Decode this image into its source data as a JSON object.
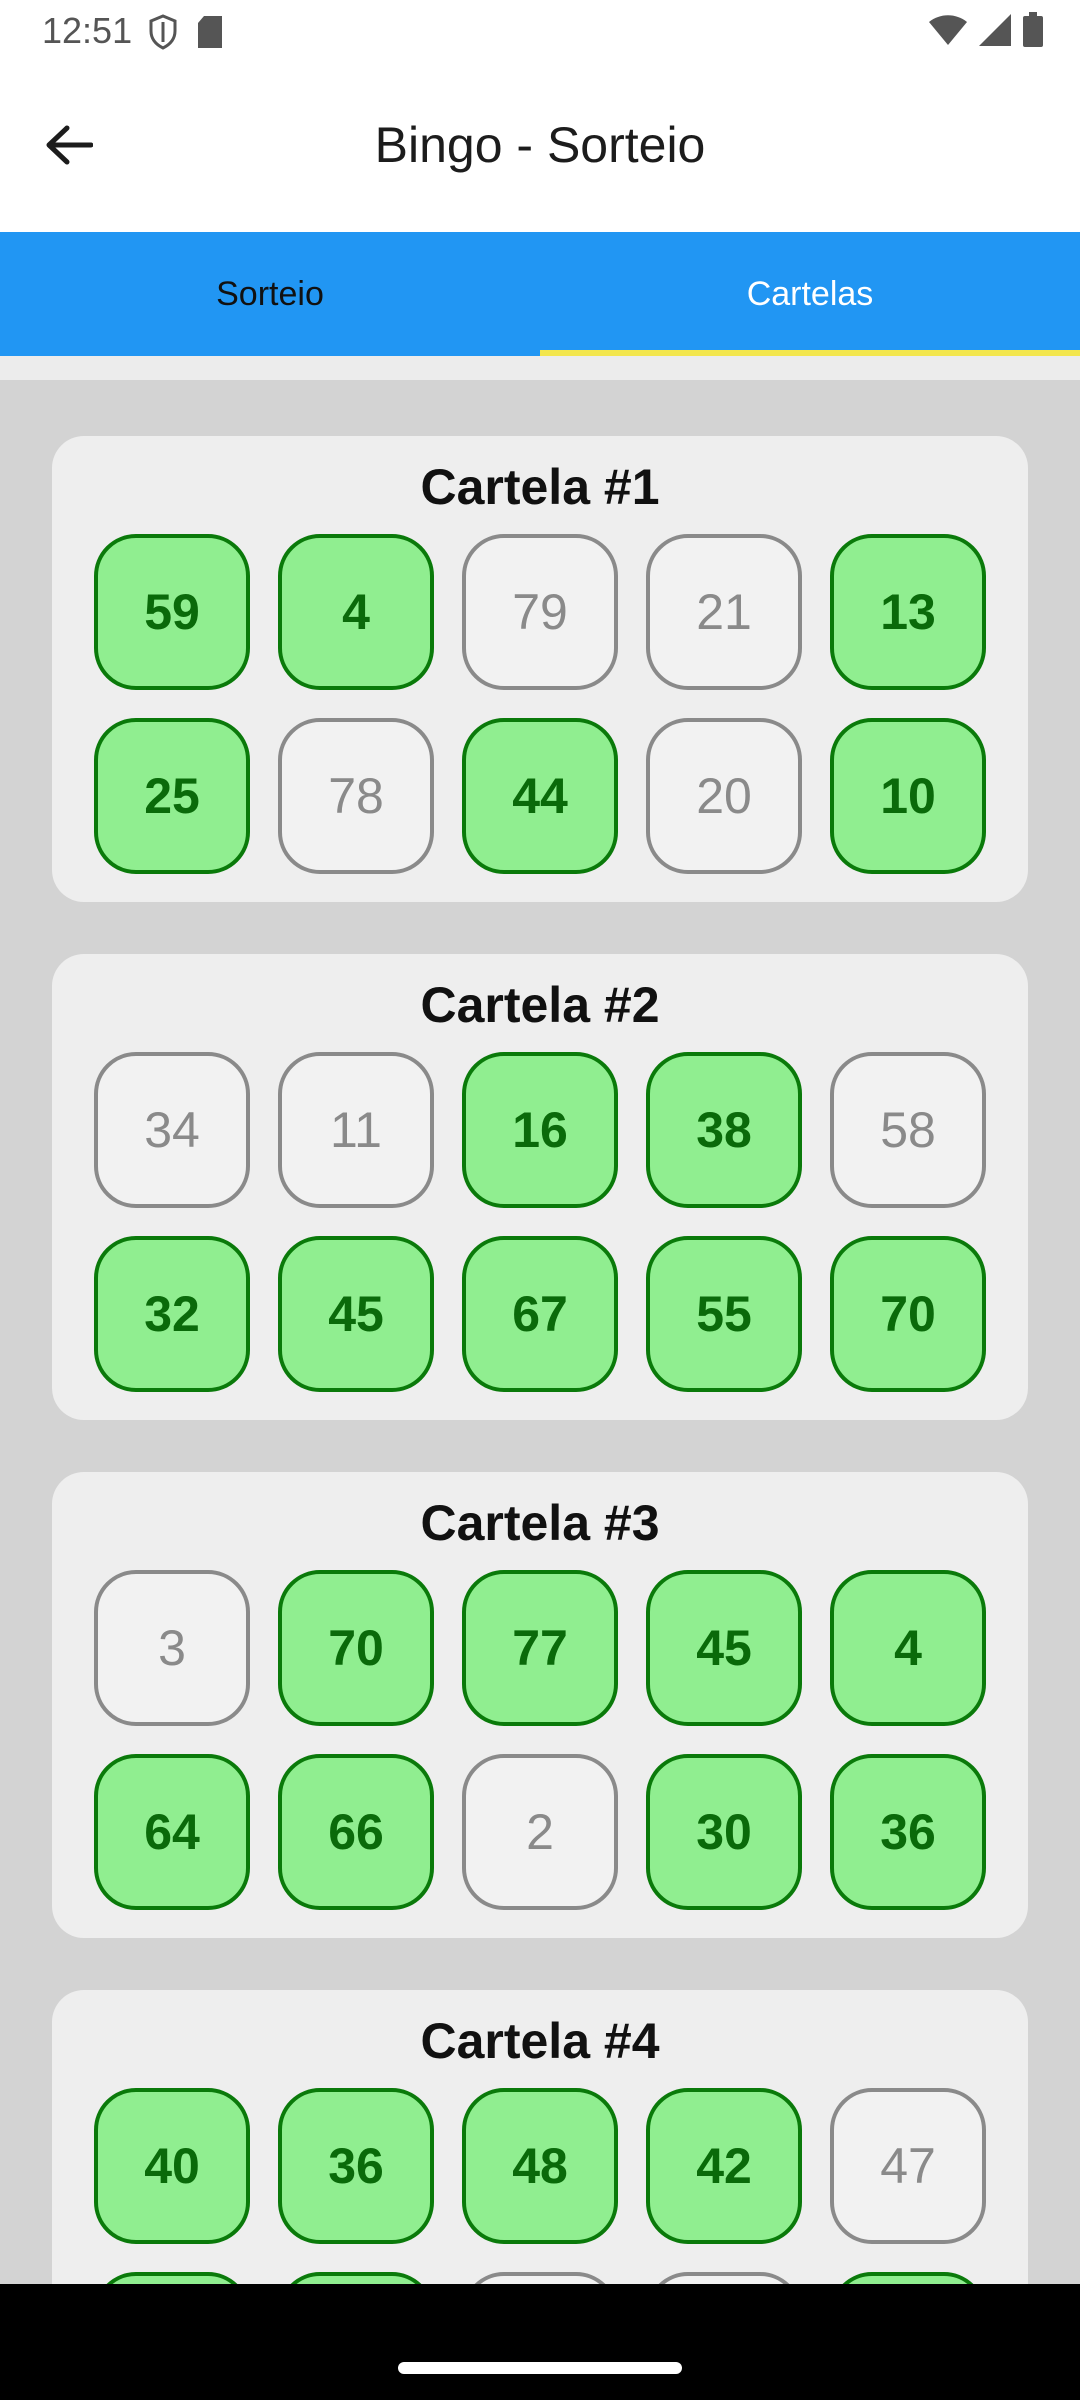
{
  "status_bar": {
    "time": "12:51"
  },
  "header": {
    "title": "Bingo - Sorteio"
  },
  "tabs": [
    {
      "label": "Sorteio",
      "active": false
    },
    {
      "label": "Cartelas",
      "active": true
    }
  ],
  "colors": {
    "primary": "#2196f3",
    "indicator": "#f3e64d",
    "marked_fill": "#90ee90",
    "marked_text": "#0a6a0a",
    "unmarked": "#8a8a8a"
  },
  "cards": [
    {
      "title": "Cartela #1",
      "numbers": [
        {
          "value": "59",
          "marked": true
        },
        {
          "value": "4",
          "marked": true
        },
        {
          "value": "79",
          "marked": false
        },
        {
          "value": "21",
          "marked": false
        },
        {
          "value": "13",
          "marked": true
        },
        {
          "value": "25",
          "marked": true
        },
        {
          "value": "78",
          "marked": false
        },
        {
          "value": "44",
          "marked": true
        },
        {
          "value": "20",
          "marked": false
        },
        {
          "value": "10",
          "marked": true
        }
      ]
    },
    {
      "title": "Cartela #2",
      "numbers": [
        {
          "value": "34",
          "marked": false
        },
        {
          "value": "11",
          "marked": false
        },
        {
          "value": "16",
          "marked": true
        },
        {
          "value": "38",
          "marked": true
        },
        {
          "value": "58",
          "marked": false
        },
        {
          "value": "32",
          "marked": true
        },
        {
          "value": "45",
          "marked": true
        },
        {
          "value": "67",
          "marked": true
        },
        {
          "value": "55",
          "marked": true
        },
        {
          "value": "70",
          "marked": true
        }
      ]
    },
    {
      "title": "Cartela #3",
      "numbers": [
        {
          "value": "3",
          "marked": false
        },
        {
          "value": "70",
          "marked": true
        },
        {
          "value": "77",
          "marked": true
        },
        {
          "value": "45",
          "marked": true
        },
        {
          "value": "4",
          "marked": true
        },
        {
          "value": "64",
          "marked": true
        },
        {
          "value": "66",
          "marked": true
        },
        {
          "value": "2",
          "marked": false
        },
        {
          "value": "30",
          "marked": true
        },
        {
          "value": "36",
          "marked": true
        }
      ]
    },
    {
      "title": "Cartela #4",
      "numbers": [
        {
          "value": "40",
          "marked": true
        },
        {
          "value": "36",
          "marked": true
        },
        {
          "value": "48",
          "marked": true
        },
        {
          "value": "42",
          "marked": true
        },
        {
          "value": "47",
          "marked": false
        },
        {
          "value": "",
          "marked": true
        },
        {
          "value": "",
          "marked": true
        },
        {
          "value": "",
          "marked": false
        },
        {
          "value": "",
          "marked": false
        },
        {
          "value": "",
          "marked": true
        }
      ]
    }
  ]
}
